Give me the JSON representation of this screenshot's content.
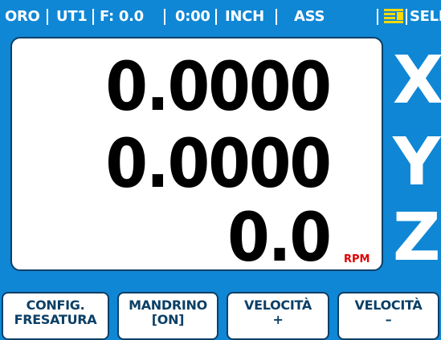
{
  "status_bar": {
    "mode": "ORO",
    "tool": "UT1",
    "feed": "F: 0.0",
    "time": "0:00",
    "units": "INCH",
    "reference": "ASS",
    "select": "SELEZ"
  },
  "readout": {
    "x_value": "0.0000",
    "y_value": "0.0000",
    "z_value": "0.0",
    "z_unit": "RPM"
  },
  "axes": {
    "x": "X",
    "y": "Y",
    "z": "Z"
  },
  "softkeys": [
    {
      "line1": "CONFIG.",
      "line2": "FRESATURA"
    },
    {
      "line1": "MANDRINO",
      "line2": "[ON]"
    },
    {
      "line1": "VELOCITÀ",
      "line2": "+"
    },
    {
      "line1": "VELOCITÀ",
      "line2": "–"
    }
  ],
  "colors": {
    "background": "#0f87d5",
    "panel": "#ffffff",
    "unit_text": "#e00000"
  },
  "icons": {
    "status_icon": "display-mode-icon"
  }
}
